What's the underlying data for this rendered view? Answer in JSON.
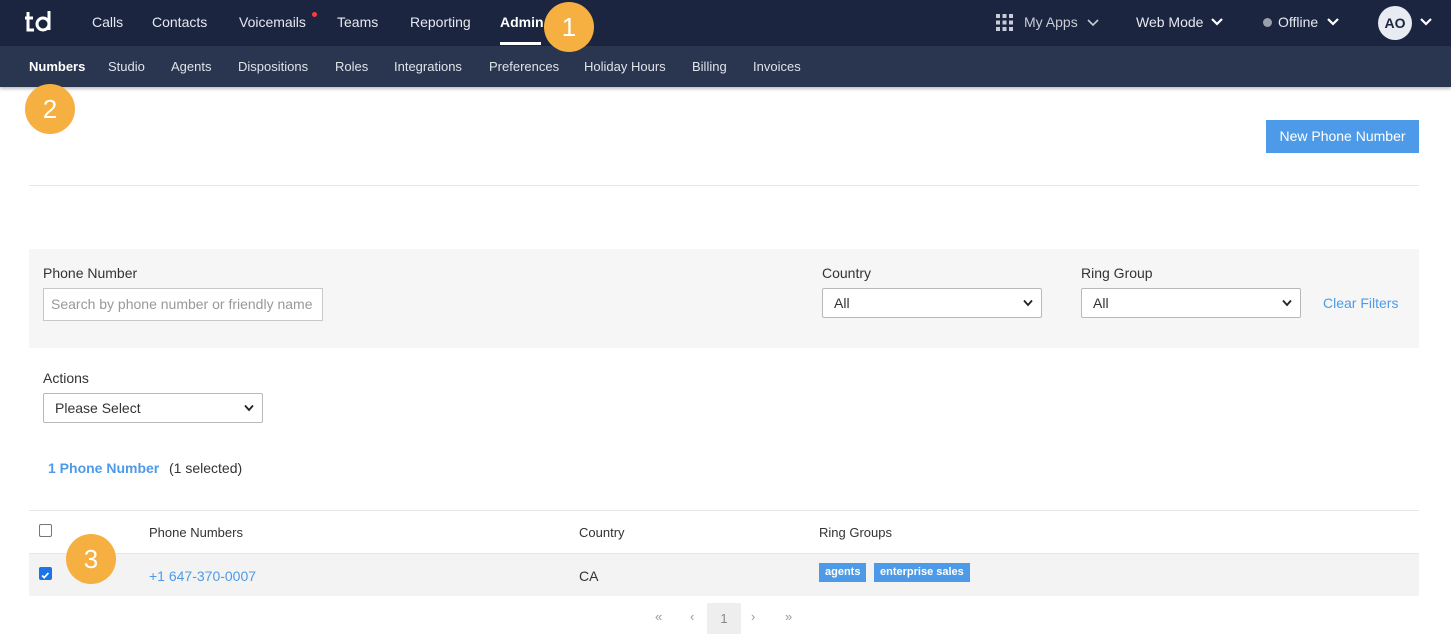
{
  "app": {
    "logo_text": "td"
  },
  "topnav": {
    "items": [
      "Calls",
      "Contacts",
      "Voicemails",
      "Teams",
      "Reporting",
      "Admin"
    ],
    "active": "Admin",
    "my_apps": "My Apps",
    "web_mode": "Web Mode",
    "status": "Offline",
    "avatar_initials": "AO"
  },
  "subnav": {
    "items": [
      "Numbers",
      "Studio",
      "Agents",
      "Dispositions",
      "Roles",
      "Integrations",
      "Preferences",
      "Holiday Hours",
      "Billing",
      "Invoices"
    ],
    "active": "Numbers"
  },
  "callouts": [
    "1",
    "2",
    "3"
  ],
  "actions": {
    "new_phone_number": "New Phone Number"
  },
  "filters": {
    "phone_number_label": "Phone Number",
    "phone_number_placeholder": "Search by phone number or friendly name",
    "country_label": "Country",
    "country_value": "All",
    "ring_group_label": "Ring Group",
    "ring_group_value": "All",
    "clear_filters": "Clear Filters"
  },
  "bulk_actions": {
    "label": "Actions",
    "value": "Please Select"
  },
  "summary": {
    "count_link": "1 Phone Number",
    "selected": "(1 selected)"
  },
  "table": {
    "headers": [
      "Phone Numbers",
      "Country",
      "Ring Groups"
    ],
    "rows": [
      {
        "checked": true,
        "phone": "+1 647-370-0007",
        "country": "CA",
        "ring_groups": [
          "agents",
          "enterprise sales"
        ]
      }
    ]
  },
  "pagination": {
    "first": "«",
    "prev": "‹",
    "current": "1",
    "next": "›",
    "last": "»"
  },
  "colors": {
    "topbar": "#1b2540",
    "subbar": "#2a3550",
    "accent": "#4d9be8",
    "callout": "#f5b041"
  }
}
